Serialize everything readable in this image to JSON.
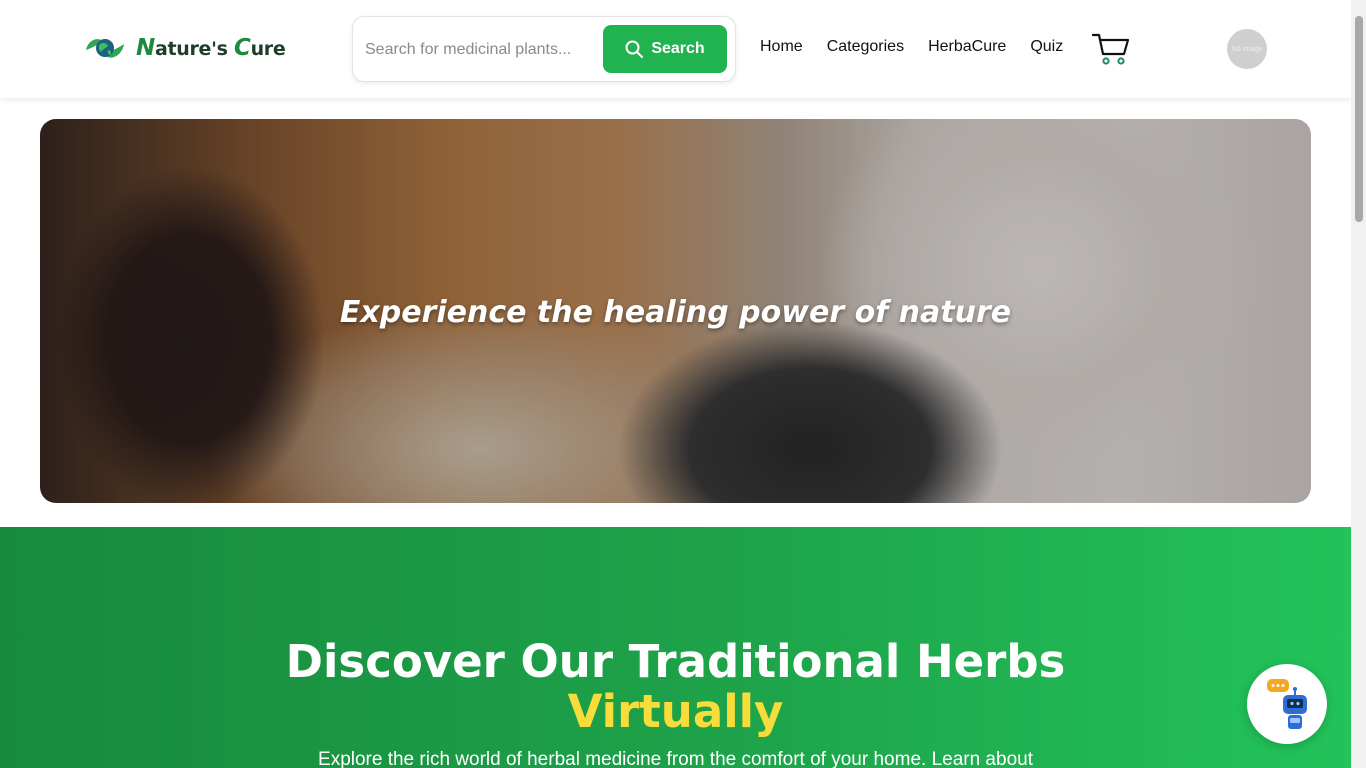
{
  "brand": {
    "name_first_initial": "N",
    "name_part1": "ature's ",
    "name_second_initial": "C",
    "name_part2": "ure",
    "logo_icon": "globe-leaf-icon"
  },
  "search": {
    "placeholder": "Search for medicinal plants...",
    "button_label": "Search",
    "icon": "search-icon"
  },
  "nav": {
    "items": [
      {
        "label": "Home"
      },
      {
        "label": "Categories"
      },
      {
        "label": "HerbaCure"
      },
      {
        "label": "Quiz"
      }
    ]
  },
  "cart": {
    "icon": "cart-icon"
  },
  "avatar": {
    "alt": "No Image"
  },
  "hero": {
    "title": "Experience the healing power of nature"
  },
  "section": {
    "heading": "Discover Our Traditional Herbs",
    "heading_highlight": "Virtually",
    "description": "Explore the rich world of herbal medicine from the comfort of your home. Learn about"
  },
  "chatbot": {
    "icon": "chatbot-robot-icon"
  },
  "colors": {
    "primary_green": "#22b351",
    "highlight_yellow": "#f7dc3a",
    "dark_text": "#1f3d2a"
  }
}
